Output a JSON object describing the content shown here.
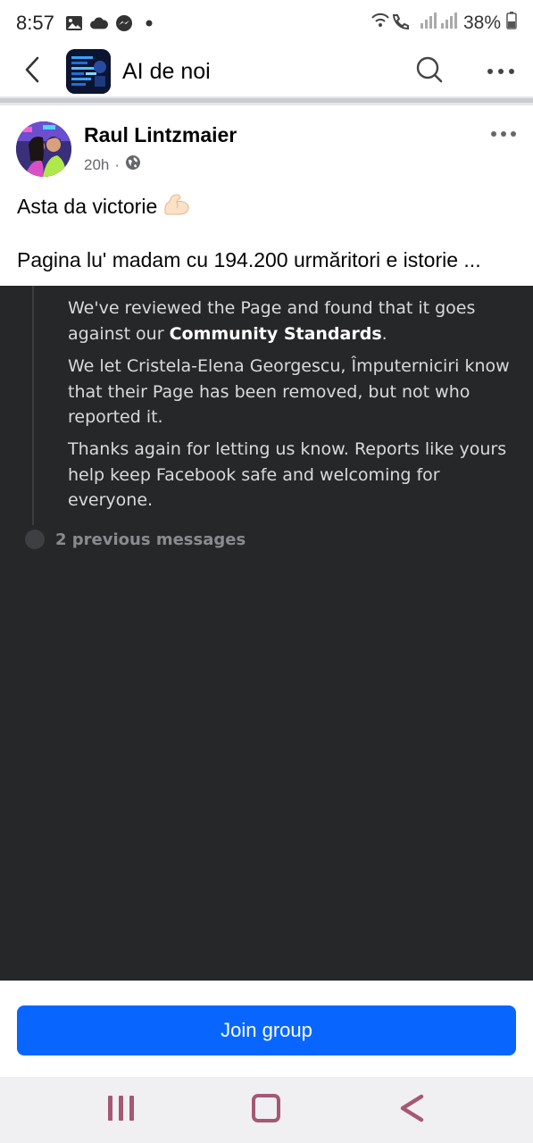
{
  "status_bar": {
    "time": "8:57",
    "battery": "38%",
    "left_icons": [
      "image-icon",
      "cloud-icon",
      "messenger-icon",
      "dot-icon"
    ],
    "right_icons": [
      "wifi-calling-icon",
      "signal-icon",
      "battery-icon"
    ]
  },
  "header": {
    "title": "AI de noi",
    "back_icon": "chevron-left-icon",
    "search_icon": "search-icon",
    "more_icon": "more-horizontal-icon"
  },
  "post": {
    "author": "Raul Lintzmaier",
    "time": "20h",
    "separator": "·",
    "audience_icon": "globe-icon",
    "text_line_1": "Asta da victorie",
    "text_line_1_emoji": "💪🏻",
    "text_line_2": "Pagina lu' madam cu 194.200 urmăritori e istorie ...",
    "more_icon": "more-horizontal-icon"
  },
  "media": {
    "paragraph_1_pre": "We've reviewed the Page and found that it goes against our ",
    "paragraph_1_bold": "Community Standards",
    "paragraph_1_post": ".",
    "paragraph_2": "We let Cristela-Elena Georgescu, Împuterniciri know that their Page has been removed, but not who reported it.",
    "paragraph_3": "Thanks again for letting us know. Reports like yours help keep Facebook safe and welcoming for everyone.",
    "previous_messages": "2 previous messages"
  },
  "join": {
    "label": "Join group"
  },
  "nav_bar": {
    "recents_icon": "recents-icon",
    "home_icon": "home-icon",
    "back_icon": "back-icon"
  },
  "colors": {
    "accent": "#0866ff",
    "media_bg": "#262729",
    "nav_icon": "#a55873"
  }
}
